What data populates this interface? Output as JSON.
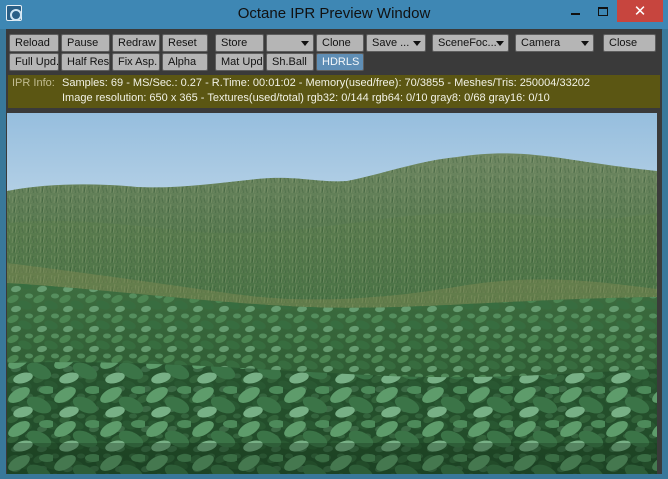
{
  "window": {
    "title": "Octane IPR Preview Window",
    "close_glyph": "✕"
  },
  "toolbar": {
    "row1": [
      {
        "label": "Reload",
        "name": "reload-button"
      },
      {
        "label": "Pause",
        "name": "pause-button"
      },
      {
        "label": "Redraw",
        "name": "redraw-button"
      },
      {
        "label": "Reset",
        "name": "reset-button"
      },
      {
        "label": "Store",
        "name": "store-button"
      },
      {
        "label": "",
        "name": "store-slot-dropdown"
      },
      {
        "label": "Clone",
        "name": "clone-button"
      },
      {
        "label": "Save ...",
        "name": "save-dropdown"
      },
      {
        "label": "SceneFoc...",
        "name": "scene-focus-dropdown"
      },
      {
        "label": "Camera",
        "name": "camera-dropdown"
      },
      {
        "label": "Close",
        "name": "close-button"
      }
    ],
    "row2": [
      {
        "label": "Full Upd.",
        "name": "full-update-button"
      },
      {
        "label": "Half Res",
        "name": "half-res-button"
      },
      {
        "label": "Fix Asp.",
        "name": "fix-aspect-button"
      },
      {
        "label": "Alpha",
        "name": "alpha-button"
      },
      {
        "label": "Mat Upd",
        "name": "mat-update-button"
      },
      {
        "label": "Sh.Ball",
        "name": "shader-ball-button"
      },
      {
        "label": "HDRLS",
        "name": "hdrls-button"
      }
    ]
  },
  "ipr_info": {
    "label": "IPR Info:",
    "line1": "Samples: 69  -  MS/Sec.: 0.27  -  R.Time: 00:01:02 - Memory(used/free): 70/3855  -  Meshes/Tris: 250004/33202",
    "line2": "Image resolution: 650 x 365 - Textures(used/total) rgb32: 0/144   rgb64: 0/10   gray8: 0/68   gray16: 0/10"
  },
  "colors": {
    "window_frame": "#3e87b4",
    "close_button": "#c7453e",
    "info_panel": "#5b5613",
    "button_face": "#b5b5b5",
    "active_button": "#5f8eb5"
  }
}
